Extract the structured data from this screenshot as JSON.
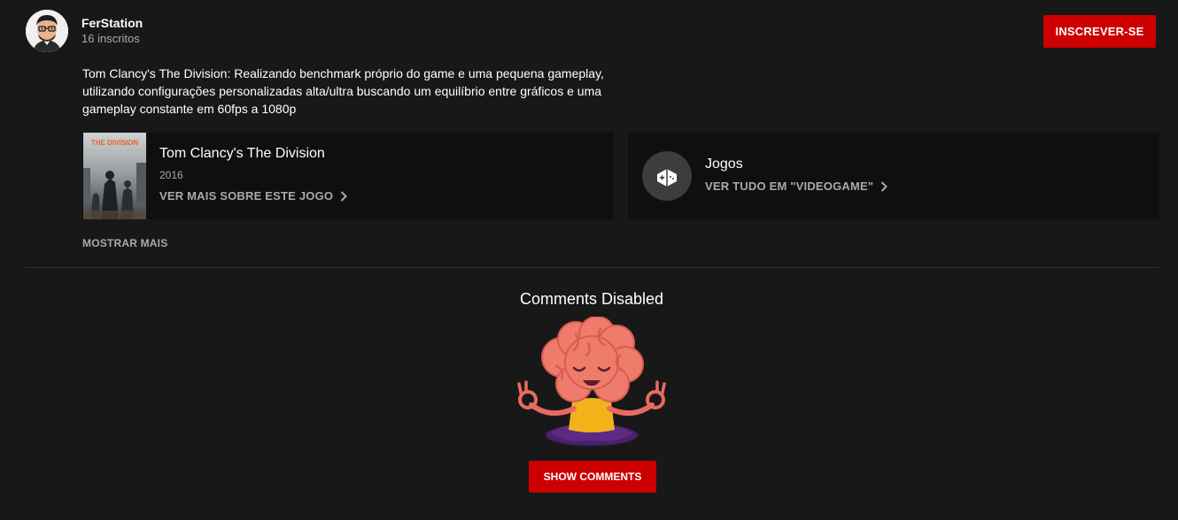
{
  "owner": {
    "channel_name": "FerStation",
    "subscribers": "16 inscritos",
    "subscribe_label": "INSCREVER-SE"
  },
  "description": {
    "text": "Tom Clancy's The Division: Realizando benchmark próprio do game e uma pequena gameplay, utilizando configurações personalizadas alta/ultra buscando um equilíbrio entre gráficos e uma gameplay constante em 60fps a 1080p"
  },
  "game_card": {
    "boxart_text": "THE DIVISION",
    "title": "Tom Clancy's The Division",
    "year": "2016",
    "link_label": "VER MAIS SOBRE ESTE JOGO"
  },
  "category_card": {
    "icon": "gamepad-icon",
    "title": "Jogos",
    "link_label": "VER TUDO EM \"VIDEOGAME\""
  },
  "show_more_label": "MOSTRAR MAIS",
  "comments": {
    "title": "Comments Disabled",
    "illustration": "meditating-brain",
    "button_label": "SHOW COMMENTS"
  },
  "colors": {
    "background": "#181818",
    "card": "#0f0f0f",
    "accent_red": "#cc0000",
    "secondary_text": "#aaaaaa"
  }
}
